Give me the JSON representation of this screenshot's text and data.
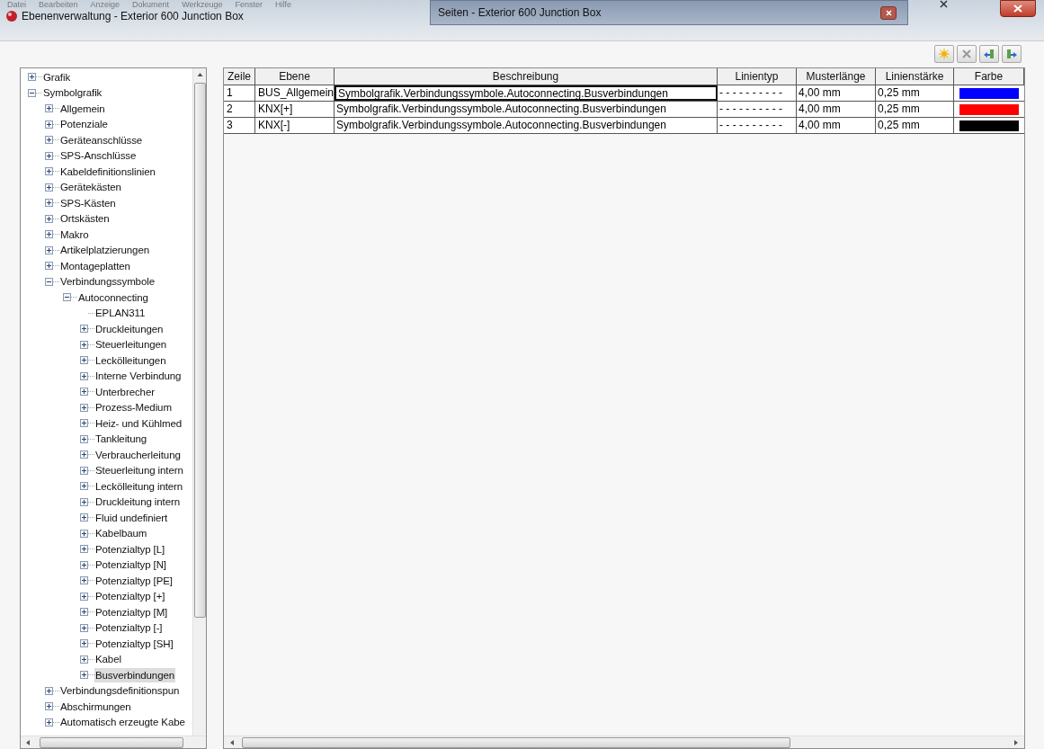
{
  "menu": [
    "Datei",
    "Bearbeiten",
    "Anzeige",
    "Dokument",
    "Werkzeuge",
    "Fenster",
    "Hilfe"
  ],
  "window": {
    "title": "Ebenenverwaltung - Exterior 600 Junction Box"
  },
  "back_window": {
    "title": "Seiten - Exterior 600 Junction Box"
  },
  "tree": [
    {
      "label": "Grafik",
      "kind": "group",
      "expanded": false,
      "selected": false
    },
    {
      "label": "Symbolgrafik",
      "kind": "group",
      "expanded": true,
      "selected": false,
      "children": [
        {
          "label": "Allgemein",
          "kind": "group",
          "expanded": false,
          "selected": false
        },
        {
          "label": "Potenziale",
          "kind": "group",
          "expanded": false,
          "selected": false
        },
        {
          "label": "Geräteanschlüsse",
          "kind": "group",
          "expanded": false,
          "selected": false
        },
        {
          "label": "SPS-Anschlüsse",
          "kind": "group",
          "expanded": false,
          "selected": false
        },
        {
          "label": "Kabeldefinitionslinien",
          "kind": "group",
          "expanded": false,
          "selected": false
        },
        {
          "label": "Gerätekästen",
          "kind": "group",
          "expanded": false,
          "selected": false
        },
        {
          "label": "SPS-Kästen",
          "kind": "group",
          "expanded": false,
          "selected": false
        },
        {
          "label": "Ortskästen",
          "kind": "group",
          "expanded": false,
          "selected": false
        },
        {
          "label": "Makro",
          "kind": "group",
          "expanded": false,
          "selected": false
        },
        {
          "label": "Artikelplatzierungen",
          "kind": "group",
          "expanded": false,
          "selected": false
        },
        {
          "label": "Montageplatten",
          "kind": "group",
          "expanded": false,
          "selected": false
        },
        {
          "label": "Verbindungssymbole",
          "kind": "group",
          "expanded": true,
          "selected": false,
          "children": [
            {
              "label": "Autoconnecting",
              "kind": "group",
              "expanded": true,
              "selected": false,
              "children": [
                {
                  "label": "EPLAN311",
                  "kind": "leaf",
                  "selected": false
                },
                {
                  "label": "Druckleitungen",
                  "kind": "group",
                  "expanded": false,
                  "selected": false
                },
                {
                  "label": "Steuerleitungen",
                  "kind": "group",
                  "expanded": false,
                  "selected": false
                },
                {
                  "label": "Leckölleitungen",
                  "kind": "group",
                  "expanded": false,
                  "selected": false
                },
                {
                  "label": "Interne Verbindung",
                  "kind": "group",
                  "expanded": false,
                  "selected": false
                },
                {
                  "label": "Unterbrecher",
                  "kind": "group",
                  "expanded": false,
                  "selected": false
                },
                {
                  "label": "Prozess-Medium",
                  "kind": "group",
                  "expanded": false,
                  "selected": false
                },
                {
                  "label": "Heiz- und Kühlmed",
                  "kind": "group",
                  "expanded": false,
                  "selected": false
                },
                {
                  "label": "Tankleitung",
                  "kind": "group",
                  "expanded": false,
                  "selected": false
                },
                {
                  "label": "Verbraucherleitung",
                  "kind": "group",
                  "expanded": false,
                  "selected": false
                },
                {
                  "label": "Steuerleitung intern",
                  "kind": "group",
                  "expanded": false,
                  "selected": false
                },
                {
                  "label": "Leckölleitung intern",
                  "kind": "group",
                  "expanded": false,
                  "selected": false
                },
                {
                  "label": "Druckleitung intern",
                  "kind": "group",
                  "expanded": false,
                  "selected": false
                },
                {
                  "label": "Fluid undefiniert",
                  "kind": "group",
                  "expanded": false,
                  "selected": false
                },
                {
                  "label": "Kabelbaum",
                  "kind": "group",
                  "expanded": false,
                  "selected": false
                },
                {
                  "label": "Potenzialtyp [L]",
                  "kind": "group",
                  "expanded": false,
                  "selected": false
                },
                {
                  "label": "Potenzialtyp [N]",
                  "kind": "group",
                  "expanded": false,
                  "selected": false
                },
                {
                  "label": "Potenzialtyp [PE]",
                  "kind": "group",
                  "expanded": false,
                  "selected": false
                },
                {
                  "label": "Potenzialtyp [+]",
                  "kind": "group",
                  "expanded": false,
                  "selected": false
                },
                {
                  "label": "Potenzialtyp [M]",
                  "kind": "group",
                  "expanded": false,
                  "selected": false
                },
                {
                  "label": "Potenzialtyp [-]",
                  "kind": "group",
                  "expanded": false,
                  "selected": false
                },
                {
                  "label": "Potenzialtyp [SH]",
                  "kind": "group",
                  "expanded": false,
                  "selected": false
                },
                {
                  "label": "Kabel",
                  "kind": "group",
                  "expanded": false,
                  "selected": false
                },
                {
                  "label": "Busverbindungen",
                  "kind": "group",
                  "expanded": false,
                  "selected": true
                }
              ]
            }
          ]
        },
        {
          "label": "Verbindungsdefinitionspun",
          "kind": "group",
          "expanded": false,
          "selected": false
        },
        {
          "label": "Abschirmungen",
          "kind": "group",
          "expanded": false,
          "selected": false
        },
        {
          "label": "Automatisch erzeugte Kabe",
          "kind": "group",
          "expanded": false,
          "selected": false
        }
      ]
    }
  ],
  "table": {
    "columns": [
      "Zeile",
      "Ebene",
      "Beschreibung",
      "Linientyp",
      "Musterlänge",
      "Linienstärke",
      "Farbe"
    ],
    "rows": [
      {
        "line": "1",
        "layer": "BUS_Allgemein",
        "description": "Symbolgrafik.Verbindungssymbole.Autoconnecting.Busverbindungen",
        "line_type": "- - - - - - - - - -",
        "pattern_length": "4,00 mm",
        "line_width": "0,25 mm",
        "color": "#0000ff",
        "selected": true
      },
      {
        "line": "2",
        "layer": "KNX[+]",
        "description": "Symbolgrafik.Verbindungssymbole.Autoconnecting.Busverbindungen",
        "line_type": "- - - - - - - - - -",
        "pattern_length": "4,00 mm",
        "line_width": "0,25 mm",
        "color": "#ff0000",
        "selected": false
      },
      {
        "line": "3",
        "layer": "KNX[-]",
        "description": "Symbolgrafik.Verbindungssymbole.Autoconnecting.Busverbindungen",
        "line_type": "- - - - - - - - - -",
        "pattern_length": "4,00 mm",
        "line_width": "0,25 mm",
        "color": "#000000",
        "selected": false
      }
    ]
  }
}
